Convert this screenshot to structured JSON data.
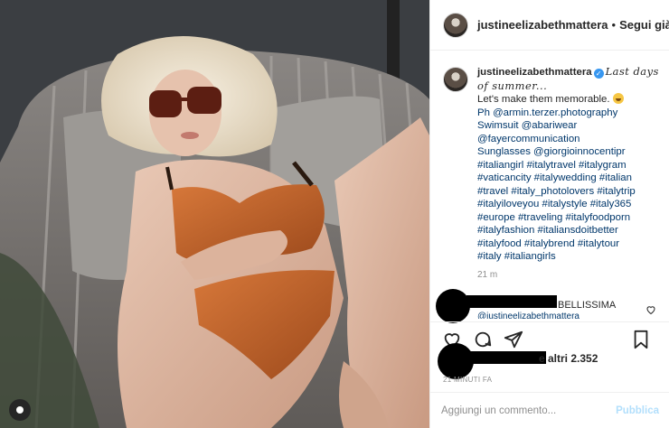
{
  "post": {
    "username": "justineelizabethmattera",
    "follow_label": "Segui già",
    "dot": "•"
  },
  "caption": {
    "username": "justineelizabethmattera",
    "title_script": "Last days of summer...",
    "lines": [
      "Let's make them memorable.",
      "Ph @armin.terzer.photography",
      "Swimsuit @abariwear",
      "@fayercommunication",
      "Sunglasses @giorgioinnocentipr",
      "#italiangirl #italytravel #italygram",
      "#vaticancity #italywedding #italian",
      "#travel #italy_photolovers #italytrip",
      "#italyiloveyou #italystyle #italy365",
      "#europe #traveling #italyfoodporn",
      "#italyfashion #italiansdoitbetter",
      "#italyfood #italybrend #italytour",
      "#italy #italiangirls"
    ],
    "time": "21 m"
  },
  "comment": {
    "text": "BELLISSIMA",
    "mention": "@justineelizabethmattera"
  },
  "likes": {
    "text": "e altri 2.352",
    "ago": "21 MINUTI FA"
  },
  "add_comment": {
    "placeholder": "Aggiungi un commento...",
    "publish": "Pubblica"
  },
  "icons": [
    "heart-icon",
    "comment-icon",
    "share-icon",
    "bookmark-icon",
    "user-icon"
  ],
  "colors": {
    "link": "#00376b",
    "publish": "#b2dffc",
    "verified": "#3897f0",
    "swimsuit": "#c0652a"
  }
}
